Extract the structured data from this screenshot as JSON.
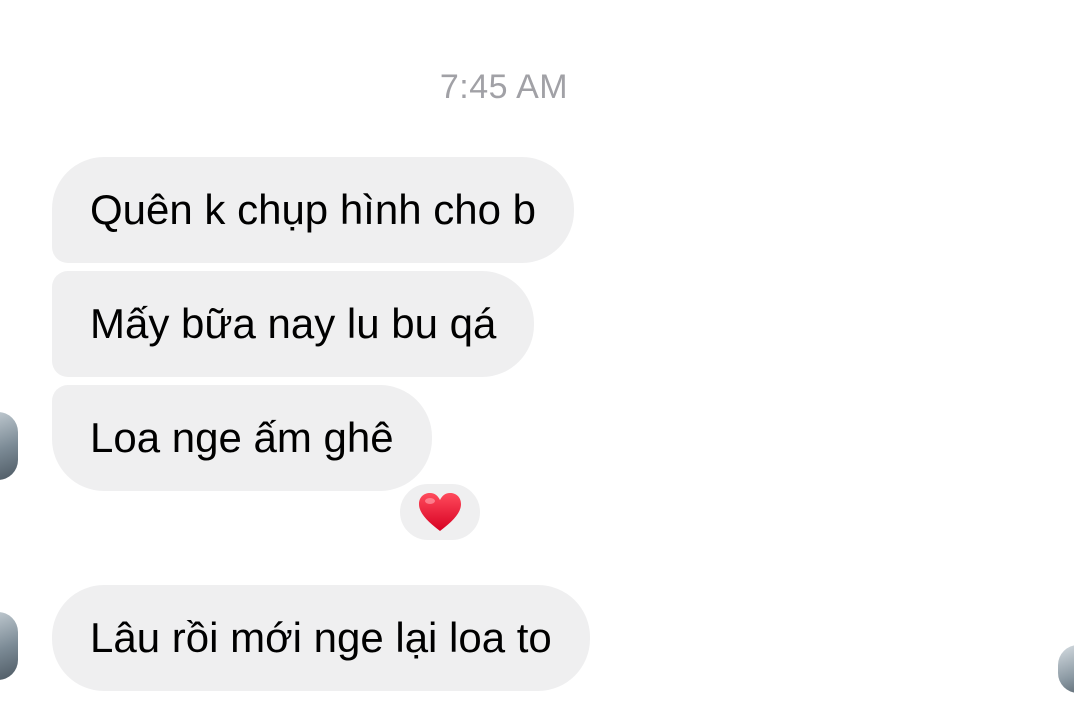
{
  "chat": {
    "timestamp": "7:45 AM",
    "messages": [
      {
        "text": "Quên k chụp hình cho b"
      },
      {
        "text": "Mấy bữa nay lu bu qá"
      },
      {
        "text": "Loa nge ấm ghê",
        "reaction": "heart-icon"
      },
      {
        "text": "Lâu rồi mới nge lại loa to"
      }
    ],
    "colors": {
      "bubble": "#efeff0",
      "timestamp": "#a1a1a6",
      "heart": "#e8112d"
    }
  }
}
